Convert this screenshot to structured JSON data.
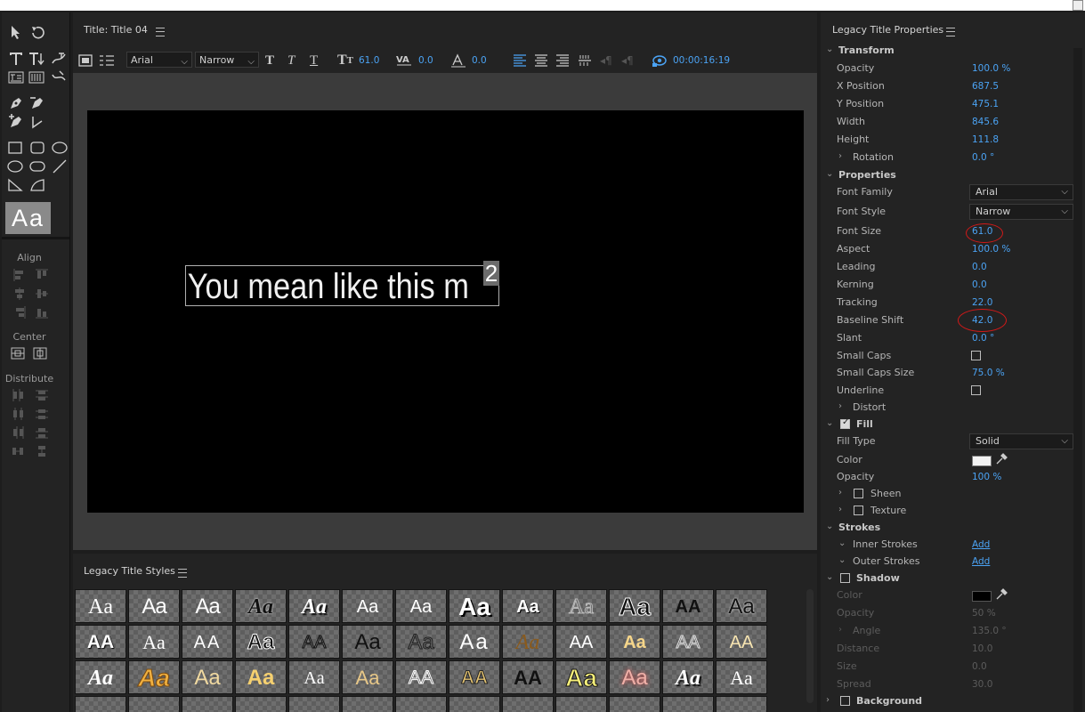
{
  "title_panel": {
    "tab_label": "Title: Title 04",
    "font_family": "Arial",
    "font_style": "Narrow",
    "font_size": "61.0",
    "kerning": "0.0",
    "baseline": "0.0",
    "timecode": "00:00:16:19",
    "canvas_text": "You mean like this m",
    "superscript": "2"
  },
  "tools": {
    "preview_text": "Aa",
    "align_label": "Align",
    "center_label": "Center",
    "distribute_label": "Distribute"
  },
  "styles_panel": {
    "tab_label": "Legacy Title Styles",
    "swatch_text": "Aa",
    "swatch_caps": "AA"
  },
  "properties": {
    "title": "Legacy Title Properties",
    "transform": {
      "header": "Transform",
      "opacity_label": "Opacity",
      "opacity": "100.0 %",
      "x_label": "X Position",
      "x": "687.5",
      "y_label": "Y Position",
      "y": "475.1",
      "width_label": "Width",
      "width": "845.6",
      "height_label": "Height",
      "height": "111.8",
      "rotation_label": "Rotation",
      "rotation": "0.0 °"
    },
    "props": {
      "header": "Properties",
      "font_family_label": "Font Family",
      "font_family": "Arial",
      "font_style_label": "Font Style",
      "font_style": "Narrow",
      "font_size_label": "Font Size",
      "font_size": "61.0",
      "aspect_label": "Aspect",
      "aspect": "100.0 %",
      "leading_label": "Leading",
      "leading": "0.0",
      "kerning_label": "Kerning",
      "kerning": "0.0",
      "tracking_label": "Tracking",
      "tracking": "22.0",
      "baseline_label": "Baseline Shift",
      "baseline": "42.0",
      "slant_label": "Slant",
      "slant": "0.0 °",
      "small_caps_label": "Small Caps",
      "small_caps_size_label": "Small Caps Size",
      "small_caps_size": "75.0 %",
      "underline_label": "Underline",
      "distort_label": "Distort"
    },
    "fill": {
      "header": "Fill",
      "fill_type_label": "Fill Type",
      "fill_type": "Solid",
      "color_label": "Color",
      "color": "#f2f2f2",
      "opacity_label": "Opacity",
      "opacity": "100 %",
      "sheen_label": "Sheen",
      "texture_label": "Texture"
    },
    "strokes": {
      "header": "Strokes",
      "inner_label": "Inner Strokes",
      "outer_label": "Outer Strokes",
      "add_label": "Add"
    },
    "shadow": {
      "header": "Shadow",
      "color_label": "Color",
      "color": "#000000",
      "opacity_label": "Opacity",
      "opacity": "50 %",
      "angle_label": "Angle",
      "angle": "135.0 °",
      "distance_label": "Distance",
      "distance": "10.0",
      "size_label": "Size",
      "size": "0.0",
      "spread_label": "Spread",
      "spread": "30.0"
    },
    "background": {
      "header": "Background"
    }
  },
  "colors": {
    "accent": "#4ba3f4",
    "annotation": "#d21919",
    "panel": "#232323"
  }
}
